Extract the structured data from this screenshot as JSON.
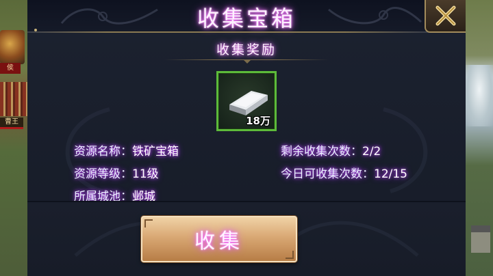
{
  "dialog": {
    "title": "收集宝箱",
    "section_title": "收集奖励",
    "close_icon": "close-x-icon"
  },
  "reward": {
    "icon": "iron-ingot-icon",
    "quantity": "18万"
  },
  "info": {
    "resource_name_label": "资源名称：",
    "resource_name_value": "铁矿宝箱",
    "resource_level_label": "资源等级：",
    "resource_level_value": "11级",
    "city_label": "所属城池：",
    "city_value": "邺城",
    "remaining_label": "剩余收集次数：",
    "remaining_value": "2/2",
    "today_label": "今日可收集次数：",
    "today_value": "12/15"
  },
  "buttons": {
    "collect_label": "收集"
  },
  "map": {
    "left_flag_text": "侯",
    "left_flag2_text": "曹王"
  },
  "colors": {
    "item_border": "#5dbb3a",
    "title_glow": "#e25cff",
    "button_gold": "#d9a874"
  }
}
